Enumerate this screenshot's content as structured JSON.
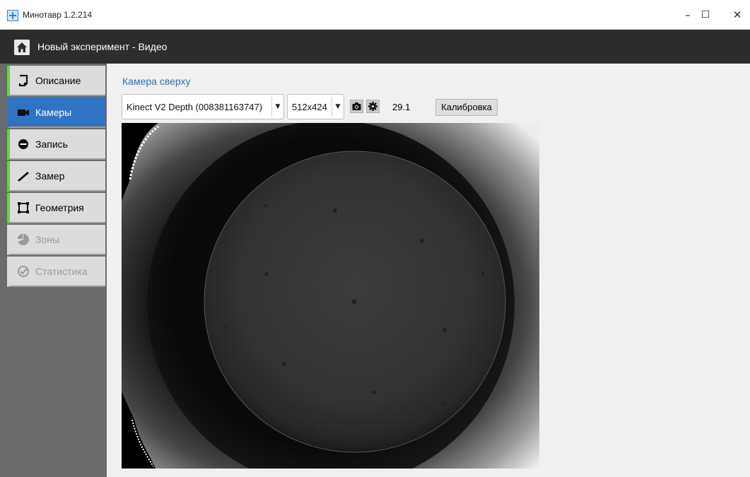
{
  "window": {
    "title": "Минотавр 1.2.214",
    "controls": {
      "minimize": "–",
      "maximize": "☐",
      "close": "✕"
    }
  },
  "header": {
    "home_icon": "home-icon",
    "title": "Новый эксперимент - Видео"
  },
  "sidebar": {
    "items": [
      {
        "label": "Описание",
        "icon": "description-icon",
        "state": "done"
      },
      {
        "label": "Камеры",
        "icon": "video-camera-icon",
        "state": "active"
      },
      {
        "label": "Запись",
        "icon": "record-icon",
        "state": "done"
      },
      {
        "label": "Замер",
        "icon": "ruler-icon",
        "state": "done"
      },
      {
        "label": "Геометрия",
        "icon": "geometry-icon",
        "state": "done"
      },
      {
        "label": "Зоны",
        "icon": "pie-chart-icon",
        "state": "disabled"
      },
      {
        "label": "Статистика",
        "icon": "statistics-icon",
        "state": "disabled"
      }
    ]
  },
  "camera": {
    "section_label": "Камера сверху",
    "device": "Kinect V2 Depth (008381163747)",
    "resolution": "512x424",
    "fps": "29.1",
    "calibrate_label": "Калибровка",
    "snapshot_icon": "camera-icon",
    "settings_icon": "gear-icon"
  },
  "colors": {
    "accent_blue": "#2f73c4",
    "done_green": "#6ccf4a",
    "header_dark": "#2d2d2d",
    "sidebar_gray": "#6b6b6b"
  }
}
